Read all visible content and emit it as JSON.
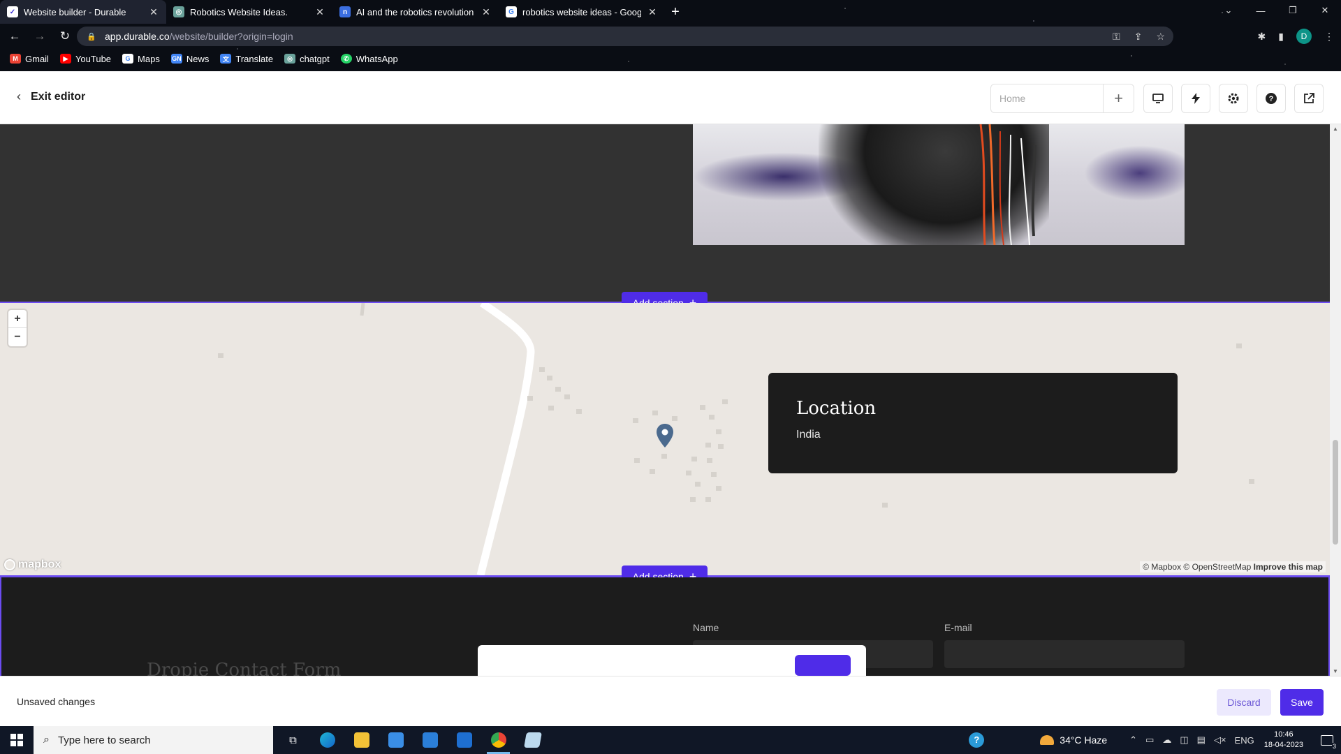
{
  "browser": {
    "tabs": [
      {
        "title": "Website builder - Durable",
        "favicon_color": "#3b2fd6",
        "active": true
      },
      {
        "title": "Robotics Website Ideas.",
        "favicon_color": "#6aa29b",
        "active": false
      },
      {
        "title": "AI and the robotics revolution W",
        "favicon_color": "#3b6ee0",
        "active": false
      },
      {
        "title": "robotics website ideas - Google",
        "favicon_color": "#ffffff",
        "active": false
      }
    ],
    "new_tab_label": "+",
    "url_host": "app.durable.co",
    "url_path": "/website/builder?origin=login",
    "avatar_letter": "D",
    "bookmarks": [
      {
        "label": "Gmail",
        "color": "#ea4335"
      },
      {
        "label": "YouTube",
        "color": "#ff0000"
      },
      {
        "label": "Maps",
        "color": "#ffffff"
      },
      {
        "label": "News",
        "color": "#4285f4"
      },
      {
        "label": "Translate",
        "color": "#4285f4"
      },
      {
        "label": "chatgpt",
        "color": "#6aa29b"
      },
      {
        "label": "WhatsApp",
        "color": "#25d366"
      }
    ]
  },
  "editor": {
    "exit_label": "Exit editor",
    "page_select_placeholder": "Home",
    "toolbar_icons": [
      "desktop-icon",
      "lightning-icon",
      "gear-icon",
      "help-icon",
      "external-link-icon"
    ]
  },
  "canvas": {
    "add_section_label": "Add section",
    "location": {
      "title": "Location",
      "value": "India"
    },
    "map": {
      "logo_text": "mapbox",
      "attribution_prefix": "© Mapbox © OpenStreetMap",
      "attribution_link": "Improve this map",
      "zoom_in": "+",
      "zoom_out": "−"
    },
    "contact": {
      "title": "Dropie Contact Form",
      "name_label": "Name",
      "email_label": "E-mail"
    }
  },
  "savebar": {
    "status": "Unsaved changes",
    "discard_label": "Discard",
    "save_label": "Save"
  },
  "taskbar": {
    "search_placeholder": "Type here to search",
    "weather": "34°C  Haze",
    "language": "ENG",
    "time": "10:46",
    "date": "18-04-2023",
    "notification_count": "3"
  },
  "colors": {
    "accent": "#4f2ce8",
    "section_outline": "#6c4cf1",
    "discard_bg": "#ece9fd"
  }
}
